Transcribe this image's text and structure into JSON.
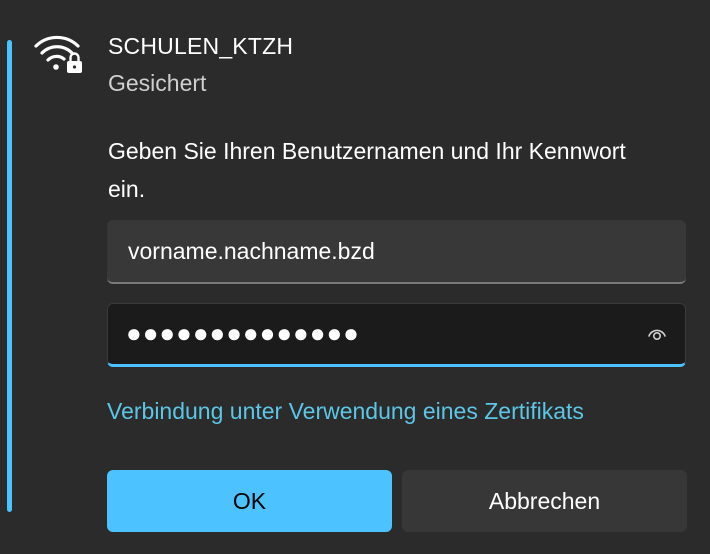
{
  "network": {
    "name": "SCHULEN_KTZH",
    "status": "Gesichert",
    "icon": "wifi-lock-icon"
  },
  "prompt": "Geben Sie Ihren Benutzernamen und Ihr Kennwort ein.",
  "username": {
    "value": "vorname.nachname.bzd"
  },
  "password": {
    "masked_value": "●●●●●●●●●●●●●●",
    "reveal_icon": "eye-icon"
  },
  "certificate_link": "Verbindung unter Verwendung eines Zertifikats",
  "buttons": {
    "ok": "OK",
    "cancel": "Abbrechen"
  },
  "colors": {
    "accent": "#4cc2ff",
    "link": "#5cc6e6",
    "background": "#2b2b2b"
  }
}
